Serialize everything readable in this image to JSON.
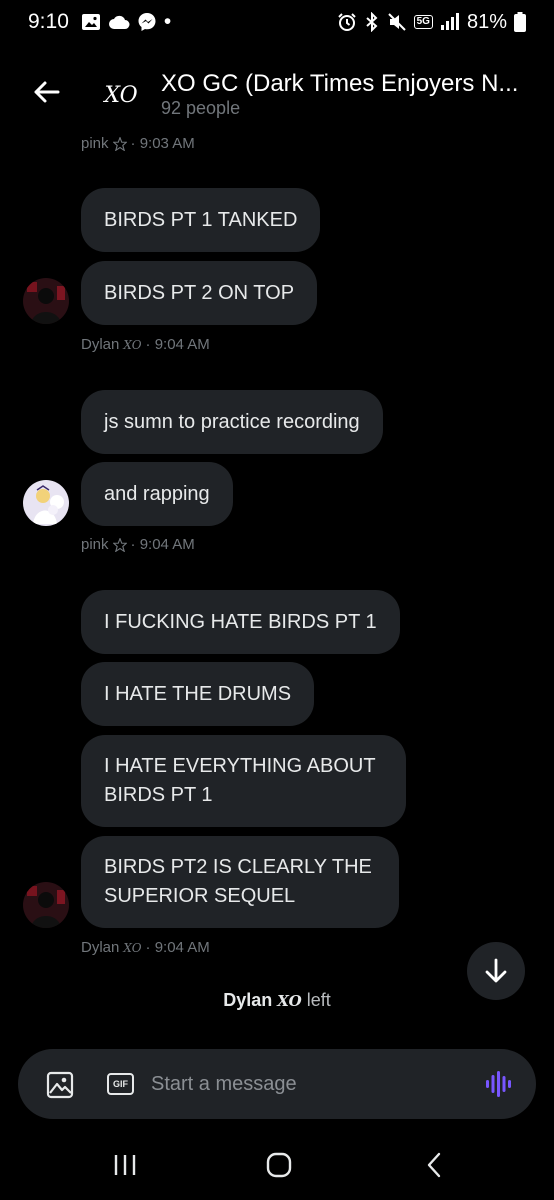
{
  "status_bar": {
    "time": "9:10",
    "dot": "•",
    "network": "5G",
    "battery": "81%",
    "icons": [
      "gallery-icon",
      "cloud-icon",
      "messenger-icon",
      "alarm-icon",
      "bluetooth-icon",
      "mute-icon",
      "signal-icon",
      "battery-icon"
    ]
  },
  "header": {
    "title": "XO GC (Dark Times Enjoyers N...",
    "subtitle": "92 people",
    "logo_text": "XO"
  },
  "messages": {
    "meta_top": {
      "sender": "pink",
      "icon": "pentagram-icon",
      "time": "· 9:03 AM"
    },
    "group1": [
      "BIRDS PT 1 TANKED",
      "BIRDS PT 2 ON TOP"
    ],
    "meta1": {
      "sender": "Dylan",
      "badge": "XO",
      "time": "· 9:04 AM"
    },
    "group2": [
      "js sumn to practice recording",
      "and rapping"
    ],
    "meta2": {
      "sender": "pink",
      "icon": "pentagram-icon",
      "time": "· 9:04 AM"
    },
    "group3": [
      "I FUCKING HATE BIRDS PT 1",
      "I HATE THE DRUMS",
      "I HATE EVERYTHING ABOUT BIRDS PT 1",
      "BIRDS PT2 IS CLEARLY THE SUPERIOR SEQUEL"
    ],
    "meta3": {
      "sender": "Dylan",
      "badge": "XO",
      "time": "· 9:04 AM"
    }
  },
  "system": {
    "name": "Dylan",
    "badge": "XO",
    "action": "left"
  },
  "composer": {
    "placeholder": "Start a message",
    "gif_label": "GIF"
  },
  "colors": {
    "accent": "#7856ff",
    "bubble": "#202327",
    "muted": "#71767b"
  }
}
